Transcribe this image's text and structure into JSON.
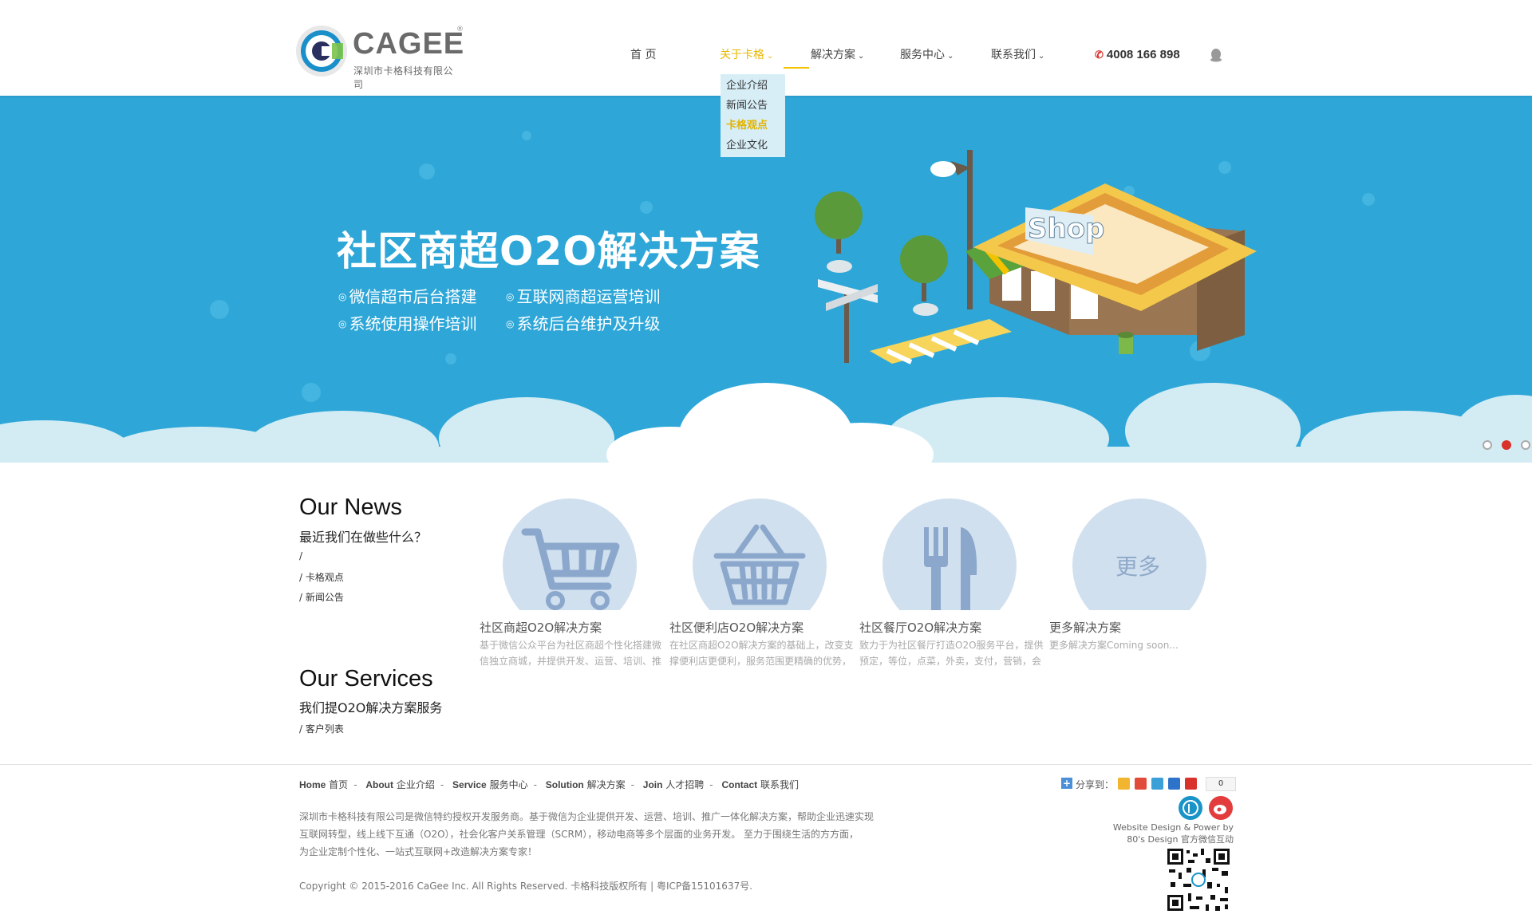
{
  "header": {
    "logo_text": "CAGEE",
    "logo_reg": "®",
    "logo_subtitle": "深圳市卡格科技有限公司",
    "nav": [
      {
        "label": "首 页",
        "chevron": false,
        "active": false
      },
      {
        "label": "关于卡格",
        "chevron": true,
        "active": true
      },
      {
        "label": "解决方案",
        "chevron": true,
        "active": false
      },
      {
        "label": "服务中心",
        "chevron": true,
        "active": false
      },
      {
        "label": "联系我们",
        "chevron": true,
        "active": false
      }
    ],
    "phone": "4008 166 898",
    "dropdown": [
      {
        "label": "企业介绍",
        "active": false
      },
      {
        "label": "新闻公告",
        "active": false
      },
      {
        "label": "卡格观点",
        "active": true
      },
      {
        "label": "企业文化",
        "active": false
      }
    ]
  },
  "banner": {
    "title": "社区商超O2O解决方案",
    "bullets": [
      "微信超市后台搭建",
      "互联网商超运营培训",
      "系统使用操作培训",
      "系统后台维护及升级"
    ],
    "shop_sign": "Shop",
    "slides_total": 3,
    "active_slide": 2
  },
  "news": {
    "title": "Our News",
    "subtitle": "最近我们在做些什么？",
    "links": [
      "/",
      "/ 卡格观点",
      "/ 新闻公告"
    ]
  },
  "services_cards": [
    {
      "icon": "shopping-cart-icon",
      "title": "社区商超O2O解决方案",
      "desc": "基于微信公众平台为社区商超个性化搭建微信独立商城，并提供开发、运营、培训、推"
    },
    {
      "icon": "shopping-basket-icon",
      "title": "社区便利店O2O解决方案",
      "desc": "在社区商超O2O解决方案的基础上，改变支撑便利店更便利，服务范围更精确的优势，"
    },
    {
      "icon": "fork-knife-icon",
      "title": "社区餐厅O2O解决方案",
      "desc": "致力于为社区餐厅打造O2O服务平台，提供预定，等位，点菜，外卖，支付，营销，会"
    },
    {
      "icon": "more-icon",
      "more_text": "更多",
      "title": "更多解决方案",
      "desc": "更多解决方案Coming soon..."
    }
  ],
  "services": {
    "title": "Our Services",
    "subtitle": "我们提O2O解决方案服务",
    "links": [
      "/ 客户列表"
    ]
  },
  "footer": {
    "nav": [
      {
        "en": "Home",
        "zh": "首页"
      },
      {
        "en": "About",
        "zh": "企业介绍"
      },
      {
        "en": "Service",
        "zh": "服务中心"
      },
      {
        "en": "Solution",
        "zh": "解决方案"
      },
      {
        "en": "Join",
        "zh": "人才招聘"
      },
      {
        "en": "Contact",
        "zh": "联系我们"
      }
    ],
    "separator": "-",
    "about_lines": [
      "深圳市卡格科技有限公司是微信特约授权开发服务商。基于微信为企业提供开发、运营、培训、推广一体化解决方案，帮助企业迅速实现",
      "互联网转型，线上线下互通（O2O），社会化客户关系管理（SCRM），移动电商等多个层面的业务开发。 至力于围绕生活的方方面，",
      "为企业定制个性化、一站式互联网+改造解决方案专家！"
    ],
    "copyright": "Copyright © 2015-2016 CaGee Inc. All Rights Reserved. 卡格科技版权所有 | 粤ICP备15101637号.",
    "share_label": "分享到：",
    "share_count": "0",
    "credit_line1": "Website Design & Power by",
    "credit_line2": "80's Design 官方微信互动"
  },
  "colors": {
    "banner_bg": "#2ea7d8",
    "accent_yellow": "#f3c300",
    "phone_red": "#d9322b",
    "circle_bg": "#d1e0ef",
    "icon_blue": "#8ba8cc"
  }
}
